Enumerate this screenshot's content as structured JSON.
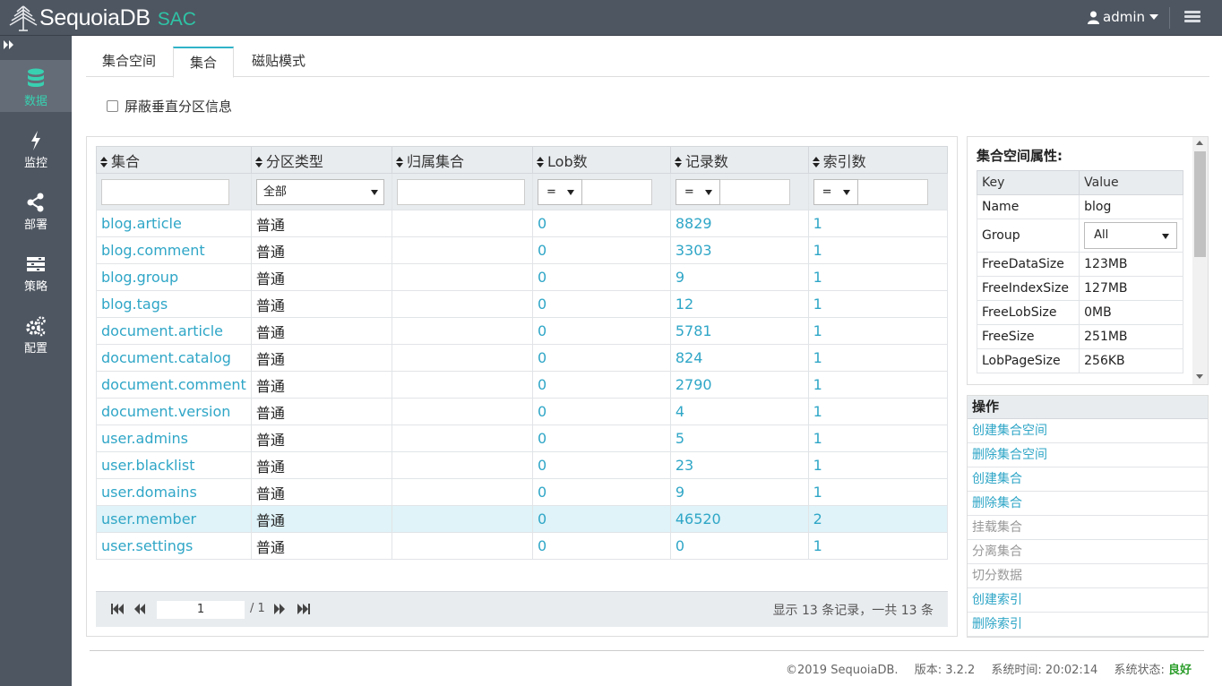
{
  "app": {
    "brand": "SequoiaDB",
    "product": "SAC"
  },
  "header": {
    "user": "admin"
  },
  "sidebar": {
    "items": [
      {
        "label": "数据",
        "icon": "database-icon",
        "active": true
      },
      {
        "label": "监控",
        "icon": "lightning-icon",
        "active": false
      },
      {
        "label": "部署",
        "icon": "share-icon",
        "active": false
      },
      {
        "label": "策略",
        "icon": "strategy-icon",
        "active": false
      },
      {
        "label": "配置",
        "icon": "gears-icon",
        "active": false
      }
    ]
  },
  "tabs": [
    {
      "label": "集合空间",
      "active": false
    },
    {
      "label": "集合",
      "active": true
    },
    {
      "label": "磁贴模式",
      "active": false
    }
  ],
  "options": {
    "hide_vertical_partition": "屏蔽垂直分区信息"
  },
  "table": {
    "columns": [
      "集合",
      "分区类型",
      "归属集合",
      "Lob数",
      "记录数",
      "索引数"
    ],
    "filters": {
      "partition_type": "全部",
      "op": "="
    },
    "rows": [
      {
        "name": "blog.article",
        "type": "普通",
        "parent": "",
        "lob": "0",
        "records": "8829",
        "indexes": "1"
      },
      {
        "name": "blog.comment",
        "type": "普通",
        "parent": "",
        "lob": "0",
        "records": "3303",
        "indexes": "1"
      },
      {
        "name": "blog.group",
        "type": "普通",
        "parent": "",
        "lob": "0",
        "records": "9",
        "indexes": "1"
      },
      {
        "name": "blog.tags",
        "type": "普通",
        "parent": "",
        "lob": "0",
        "records": "12",
        "indexes": "1"
      },
      {
        "name": "document.article",
        "type": "普通",
        "parent": "",
        "lob": "0",
        "records": "5781",
        "indexes": "1"
      },
      {
        "name": "document.catalog",
        "type": "普通",
        "parent": "",
        "lob": "0",
        "records": "824",
        "indexes": "1"
      },
      {
        "name": "document.comment",
        "type": "普通",
        "parent": "",
        "lob": "0",
        "records": "2790",
        "indexes": "1"
      },
      {
        "name": "document.version",
        "type": "普通",
        "parent": "",
        "lob": "0",
        "records": "4",
        "indexes": "1"
      },
      {
        "name": "user.admins",
        "type": "普通",
        "parent": "",
        "lob": "0",
        "records": "5",
        "indexes": "1"
      },
      {
        "name": "user.blacklist",
        "type": "普通",
        "parent": "",
        "lob": "0",
        "records": "23",
        "indexes": "1"
      },
      {
        "name": "user.domains",
        "type": "普通",
        "parent": "",
        "lob": "0",
        "records": "9",
        "indexes": "1"
      },
      {
        "name": "user.member",
        "type": "普通",
        "parent": "",
        "lob": "0",
        "records": "46520",
        "indexes": "2",
        "selected": true
      },
      {
        "name": "user.settings",
        "type": "普通",
        "parent": "",
        "lob": "0",
        "records": "0",
        "indexes": "1"
      }
    ]
  },
  "pager": {
    "page": "1",
    "total": "/ 1",
    "info": "显示 13 条记录，一共 13 条"
  },
  "properties": {
    "title": "集合空间属性:",
    "headers": [
      "Key",
      "Value"
    ],
    "rows": [
      {
        "key": "Name",
        "value": "blog"
      },
      {
        "key": "Group",
        "value": "All"
      },
      {
        "key": "FreeDataSize",
        "value": "123MB"
      },
      {
        "key": "FreeIndexSize",
        "value": "127MB"
      },
      {
        "key": "FreeLobSize",
        "value": "0MB"
      },
      {
        "key": "FreeSize",
        "value": "251MB"
      },
      {
        "key": "LobPageSize",
        "value": "256KB"
      }
    ]
  },
  "operations": {
    "title": "操作",
    "items": [
      {
        "label": "创建集合空间",
        "enabled": true
      },
      {
        "label": "删除集合空间",
        "enabled": true
      },
      {
        "label": "创建集合",
        "enabled": true
      },
      {
        "label": "删除集合",
        "enabled": true
      },
      {
        "label": "挂载集合",
        "enabled": false
      },
      {
        "label": "分离集合",
        "enabled": false
      },
      {
        "label": "切分数据",
        "enabled": false
      },
      {
        "label": "创建索引",
        "enabled": true
      },
      {
        "label": "删除索引",
        "enabled": true
      }
    ]
  },
  "footer": {
    "copyright": "©2019 SequoiaDB.",
    "version": "版本: 3.2.2",
    "time": "系统时间: 20:02:14",
    "status_label": "系统状态: ",
    "status_value": "良好",
    "status_color": "#2a9d2a"
  },
  "colors": {
    "topbar": "#4e5661",
    "accent": "#2fb3c8",
    "link": "#2fa6c7",
    "brand_green": "#2ec4a6"
  }
}
